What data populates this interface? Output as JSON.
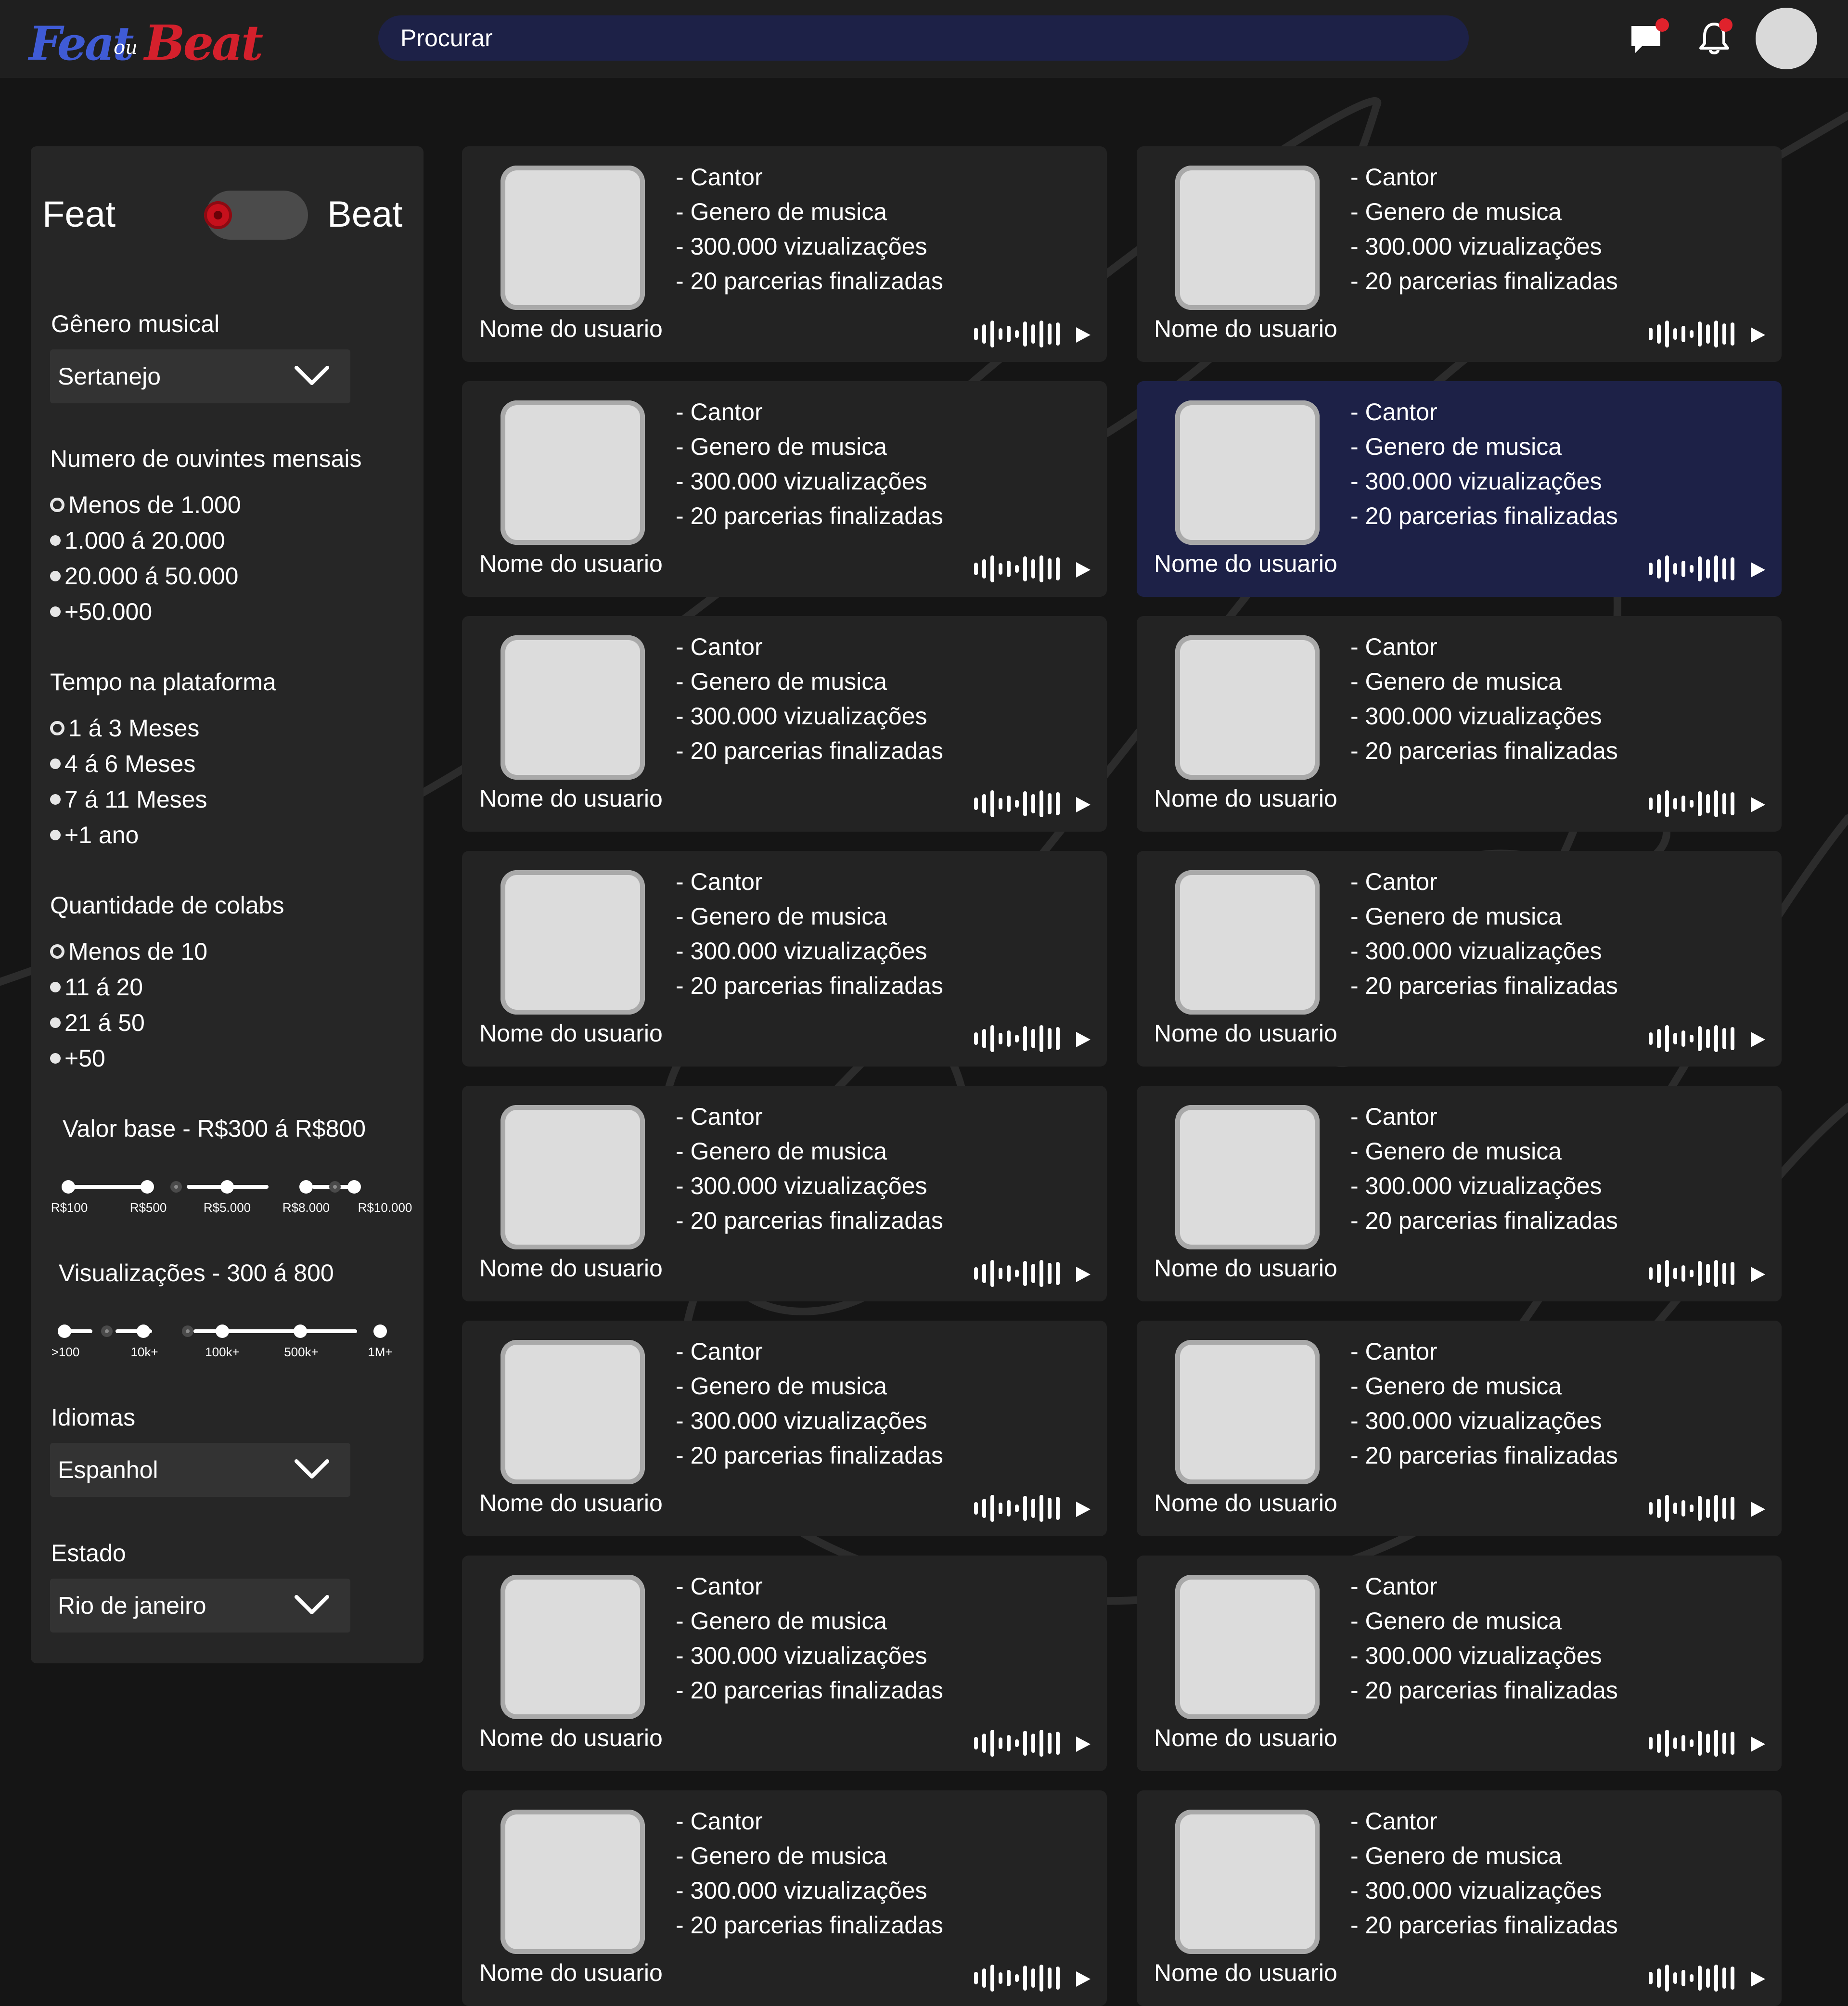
{
  "app": {
    "logo": {
      "feat": "Feat",
      "ou": "ou",
      "beat": "Beat"
    },
    "colors": {
      "background": "#151515",
      "topbar": "#1f1f1f",
      "panel": "#262626",
      "card": "#232323",
      "accent": "#1d2147",
      "brand_blue": "#3f5bd6",
      "brand_red": "#d4202c",
      "notification": "#e0222c"
    }
  },
  "header": {
    "search_placeholder": "Procurar",
    "icons": [
      "chat-icon",
      "bell-icon",
      "avatar"
    ]
  },
  "sidebar": {
    "toggle": {
      "left_label": "Feat",
      "right_label": "Beat",
      "state": "feat"
    },
    "genre": {
      "label": "Gênero musical",
      "selected": "Sertanejo"
    },
    "listeners": {
      "label": "Numero de ouvintes mensais",
      "options": [
        "Menos de 1.000",
        "1.000 á 20.000",
        "20.000 á 50.000",
        "+50.000"
      ],
      "selected_index": 0
    },
    "time": {
      "label": "Tempo na plataforma",
      "options": [
        "1 á 3 Meses",
        "4 á 6 Meses",
        "7 á 11 Meses",
        "+1 ano"
      ],
      "selected_index": 0
    },
    "colabs": {
      "label": "Quantidade de colabs",
      "options": [
        "Menos de 10",
        "11 á 20",
        "21 á 50",
        "+50"
      ],
      "selected_index": 0
    },
    "price": {
      "label": "Valor base - R$300 á R$800",
      "ticks": [
        "R$100",
        "R$500",
        "R$5.000",
        "R$8.000",
        "R$10.000"
      ]
    },
    "views": {
      "label": "Visualizações - 300 á 800",
      "ticks": [
        ">100",
        "10k+",
        "100k+",
        "500k+",
        "1M+"
      ]
    },
    "language": {
      "label": "Idiomas",
      "selected": "Espanhol"
    },
    "state": {
      "label": "Estado",
      "selected": "Rio de janeiro"
    }
  },
  "cards": [
    {
      "name": "Nome do usuario",
      "role": "- Cantor",
      "genre": "- Genero de musica",
      "views": "- 300.000 vizualizações",
      "collabs": "- 20 parcerias finalizadas"
    },
    {
      "name": "Nome do usuario",
      "role": "- Cantor",
      "genre": "- Genero de musica",
      "views": "- 300.000 vizualizações",
      "collabs": "- 20 parcerias finalizadas"
    },
    {
      "name": "Nome do usuario",
      "role": "- Cantor",
      "genre": "- Genero de musica",
      "views": "- 300.000 vizualizações",
      "collabs": "- 20 parcerias finalizadas"
    },
    {
      "name": "Nome do usuario",
      "role": "- Cantor",
      "genre": "- Genero de musica",
      "views": "- 300.000 vizualizações",
      "collabs": "- 20 parcerias finalizadas",
      "highlighted": true
    },
    {
      "name": "Nome do usuario",
      "role": "- Cantor",
      "genre": "- Genero de musica",
      "views": "- 300.000 vizualizações",
      "collabs": "- 20 parcerias finalizadas"
    },
    {
      "name": "Nome do usuario",
      "role": "- Cantor",
      "genre": "- Genero de musica",
      "views": "- 300.000 vizualizações",
      "collabs": "- 20 parcerias finalizadas"
    },
    {
      "name": "Nome do usuario",
      "role": "- Cantor",
      "genre": "- Genero de musica",
      "views": "- 300.000 vizualizações",
      "collabs": "- 20 parcerias finalizadas"
    },
    {
      "name": "Nome do usuario",
      "role": "- Cantor",
      "genre": "- Genero de musica",
      "views": "- 300.000 vizualizações",
      "collabs": "- 20 parcerias finalizadas"
    },
    {
      "name": "Nome do usuario",
      "role": "- Cantor",
      "genre": "- Genero de musica",
      "views": "- 300.000 vizualizações",
      "collabs": "- 20 parcerias finalizadas"
    },
    {
      "name": "Nome do usuario",
      "role": "- Cantor",
      "genre": "- Genero de musica",
      "views": "- 300.000 vizualizações",
      "collabs": "- 20 parcerias finalizadas"
    },
    {
      "name": "Nome do usuario",
      "role": "- Cantor",
      "genre": "- Genero de musica",
      "views": "- 300.000 vizualizações",
      "collabs": "- 20 parcerias finalizadas"
    },
    {
      "name": "Nome do usuario",
      "role": "- Cantor",
      "genre": "- Genero de musica",
      "views": "- 300.000 vizualizações",
      "collabs": "- 20 parcerias finalizadas"
    },
    {
      "name": "Nome do usuario",
      "role": "- Cantor",
      "genre": "- Genero de musica",
      "views": "- 300.000 vizualizações",
      "collabs": "- 20 parcerias finalizadas"
    },
    {
      "name": "Nome do usuario",
      "role": "- Cantor",
      "genre": "- Genero de musica",
      "views": "- 300.000 vizualizações",
      "collabs": "- 20 parcerias finalizadas"
    },
    {
      "name": "Nome do usuario",
      "role": "- Cantor",
      "genre": "- Genero de musica",
      "views": "- 300.000 vizualizações",
      "collabs": "- 20 parcerias finalizadas"
    },
    {
      "name": "Nome do usuario",
      "role": "- Cantor",
      "genre": "- Genero de musica",
      "views": "- 300.000 vizualizações",
      "collabs": "- 20 parcerias finalizadas"
    }
  ]
}
